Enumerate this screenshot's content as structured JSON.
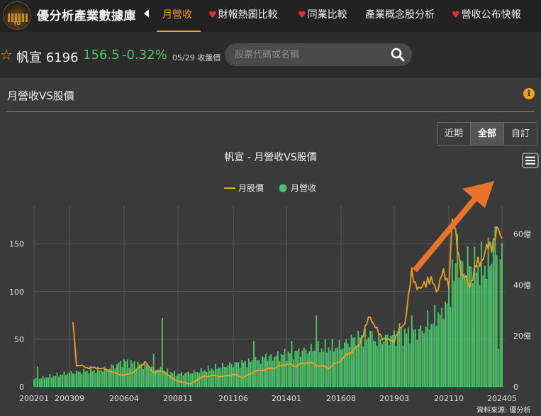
{
  "brand": {
    "name": "優分析產業數據庫",
    "logo_text": "YU"
  },
  "nav": {
    "items": [
      {
        "label": "月營收",
        "active": true,
        "heart": false
      },
      {
        "label": "財報熱圖比較",
        "active": false,
        "heart": true
      },
      {
        "label": "同業比較",
        "active": false,
        "heart": true
      },
      {
        "label": "產業概念股分析",
        "active": false,
        "heart": false
      },
      {
        "label": "營收公布快報",
        "active": false,
        "heart": true
      }
    ],
    "heart_glyph": "♥"
  },
  "stock": {
    "name": "帆宣 6196",
    "price": "156.5",
    "change": "-0.32%",
    "quote_date": "05/29 收盤價",
    "price_color": "#4cc46a"
  },
  "search": {
    "placeholder": "股票代碼或名稱"
  },
  "section": {
    "title": "月營收VS股價",
    "info_glyph": "i"
  },
  "range_buttons": [
    {
      "label": "近期",
      "active": false
    },
    {
      "label": "全部",
      "active": true
    },
    {
      "label": "自訂",
      "active": false
    }
  ],
  "source": "資料來源: 優分析",
  "colors": {
    "accent": "#f0a020",
    "revenue": "#4cc46a",
    "price": "#f0a020",
    "arrow": "#e8742a"
  },
  "chart_data": {
    "type": "bar",
    "title": "帆宣 - 月營收VS股價",
    "legend": {
      "placement": "top-center",
      "entries": [
        "月股價",
        "月營收"
      ]
    },
    "x_tick_labels": [
      "200201",
      "200309",
      "200604",
      "200811",
      "201106",
      "201401",
      "201608",
      "201903",
      "202110",
      "202405"
    ],
    "y_left": {
      "ticks": [
        "0",
        "50",
        "100",
        "150"
      ],
      "range": [
        0,
        190
      ]
    },
    "y_right": {
      "ticks": [
        "0",
        "20億",
        "40億",
        "60億"
      ],
      "range": [
        0,
        71
      ]
    },
    "grid": true,
    "series": [
      {
        "name": "月營收",
        "type": "bar",
        "axis": "right",
        "unit": "億",
        "start": "2002-01",
        "step_months": 1,
        "anchors": [
          [
            "2002-01",
            3
          ],
          [
            "2003-09",
            5.5
          ],
          [
            "2005-06",
            7
          ],
          [
            "2006-04",
            10
          ],
          [
            "2007-06",
            8
          ],
          [
            "2008-11",
            5
          ],
          [
            "2009-10",
            6
          ],
          [
            "2011-06",
            9
          ],
          [
            "2012-06",
            10
          ],
          [
            "2014-01",
            13
          ],
          [
            "2015-06",
            15
          ],
          [
            "2016-08",
            16
          ],
          [
            "2017-06",
            20
          ],
          [
            "2018-06",
            18
          ],
          [
            "2019-03",
            20
          ],
          [
            "2020-06",
            22
          ],
          [
            "2021-01",
            26
          ],
          [
            "2021-10",
            35
          ],
          [
            "2022-03",
            45
          ],
          [
            "2022-09",
            48
          ],
          [
            "2023-06",
            47
          ],
          [
            "2024-01",
            52
          ],
          [
            "2024-05",
            52
          ]
        ],
        "spikes": [
          [
            "2002-03",
            8
          ],
          [
            "2007-09",
            13
          ],
          [
            "2008-02",
            27
          ],
          [
            "2012-06",
            18
          ],
          [
            "2013-01",
            13
          ],
          [
            "2014-04",
            18
          ],
          [
            "2015-06",
            28
          ],
          [
            "2017-06",
            22
          ],
          [
            "2018-01",
            22
          ],
          [
            "2019-06",
            25
          ],
          [
            "2020-01",
            28
          ],
          [
            "2020-10",
            30
          ],
          [
            "2021-06",
            31
          ],
          [
            "2021-12",
            50
          ],
          [
            "2022-03",
            60
          ],
          [
            "2023-01",
            55
          ],
          [
            "2023-12",
            57
          ],
          [
            "2024-01",
            63
          ],
          [
            "2024-03",
            15
          ],
          [
            "2024-04",
            50
          ]
        ]
      },
      {
        "name": "月股價",
        "type": "line",
        "axis": "left",
        "start": "2003-11",
        "points": [
          [
            "2003-11",
            68
          ],
          [
            "2004-01",
            22
          ],
          [
            "2004-04",
            22
          ],
          [
            "2004-08",
            20
          ],
          [
            "2005-01",
            20
          ],
          [
            "2005-06",
            18
          ],
          [
            "2005-10",
            15
          ],
          [
            "2006-04",
            12
          ],
          [
            "2006-10",
            16
          ],
          [
            "2007-04",
            26
          ],
          [
            "2007-09",
            15
          ],
          [
            "2008-02",
            17
          ],
          [
            "2008-07",
            10
          ],
          [
            "2008-11",
            6
          ],
          [
            "2009-06",
            3
          ],
          [
            "2009-12",
            10
          ],
          [
            "2010-06",
            12
          ],
          [
            "2010-12",
            11
          ],
          [
            "2011-06",
            13
          ],
          [
            "2011-12",
            10
          ],
          [
            "2012-06",
            16
          ],
          [
            "2013-06",
            20
          ],
          [
            "2014-01",
            24
          ],
          [
            "2014-06",
            22
          ],
          [
            "2015-01",
            26
          ],
          [
            "2015-06",
            23
          ],
          [
            "2016-01",
            20
          ],
          [
            "2016-08",
            28
          ],
          [
            "2017-01",
            36
          ],
          [
            "2017-06",
            42
          ],
          [
            "2018-01",
            75
          ],
          [
            "2018-06",
            55
          ],
          [
            "2018-12",
            48
          ],
          [
            "2019-03",
            50
          ],
          [
            "2019-09",
            68
          ],
          [
            "2020-01",
            118
          ],
          [
            "2020-06",
            100
          ],
          [
            "2020-10",
            115
          ],
          [
            "2021-03",
            102
          ],
          [
            "2021-06",
            118
          ],
          [
            "2021-10",
            110
          ],
          [
            "2021-12",
            175
          ],
          [
            "2022-03",
            148
          ],
          [
            "2022-06",
            115
          ],
          [
            "2022-10",
            108
          ],
          [
            "2023-03",
            130
          ],
          [
            "2023-08",
            142
          ],
          [
            "2024-01",
            158
          ],
          [
            "2024-03",
            162
          ],
          [
            "2024-05",
            156
          ]
        ]
      }
    ]
  }
}
